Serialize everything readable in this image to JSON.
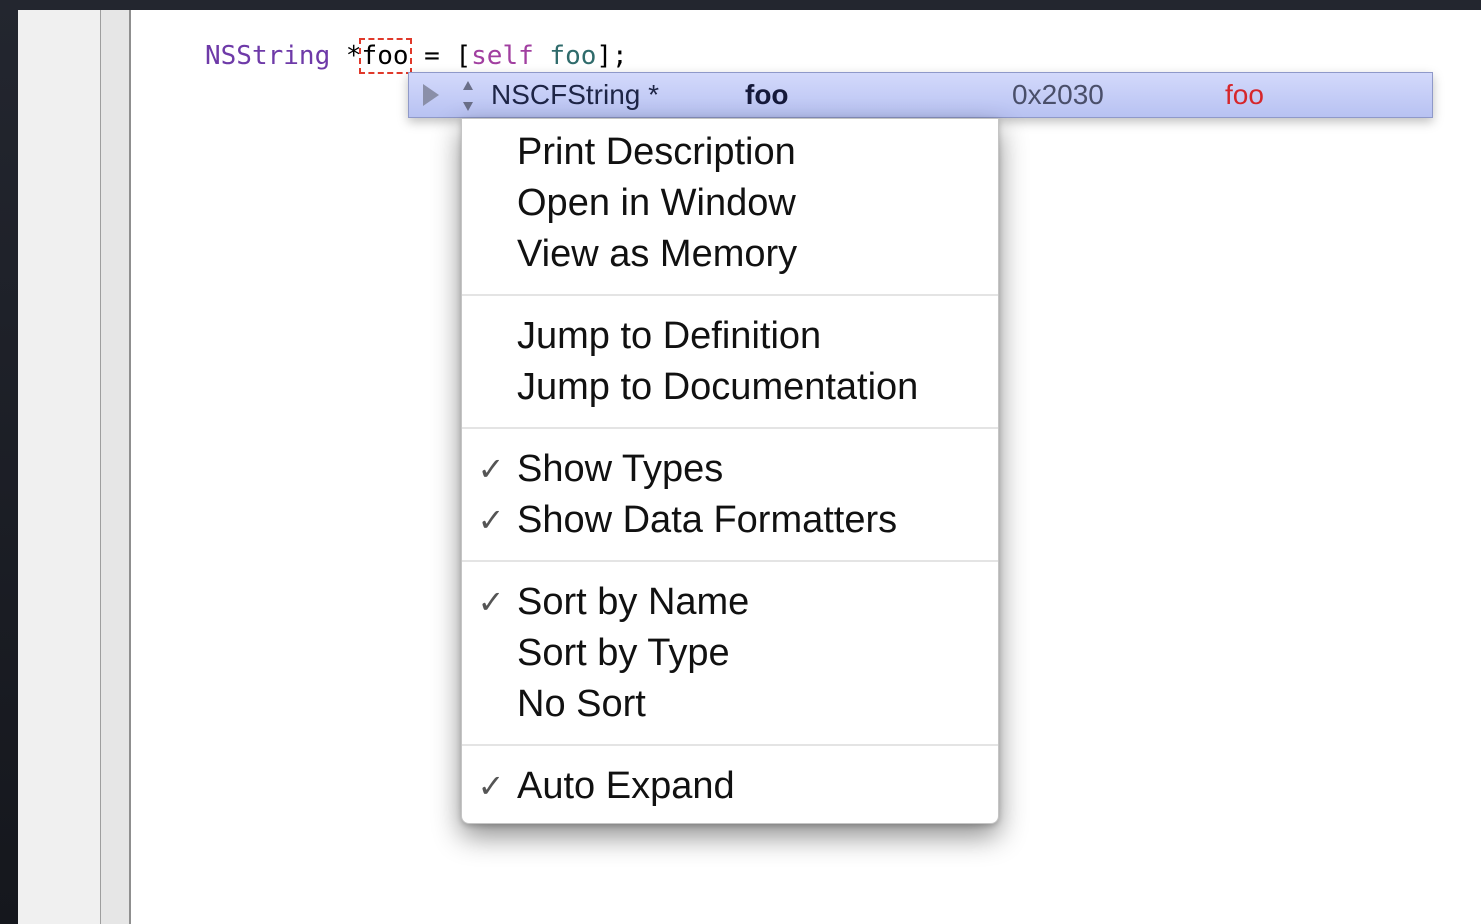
{
  "code": {
    "type_token": "NSString",
    "pointer_star": " *",
    "var_token": "foo",
    "assign": " = [",
    "self_token": "self",
    "space": " ",
    "method_token": "foo",
    "end": "];"
  },
  "datatip": {
    "type": "NSCFString *",
    "name": "foo",
    "address": "0x2030",
    "value": "foo"
  },
  "menu": {
    "groups": [
      {
        "items": [
          {
            "label": "Print Description",
            "checked": false
          },
          {
            "label": "Open in Window",
            "checked": false
          },
          {
            "label": "View as Memory",
            "checked": false
          }
        ]
      },
      {
        "items": [
          {
            "label": "Jump to Definition",
            "checked": false
          },
          {
            "label": "Jump to Documentation",
            "checked": false
          }
        ]
      },
      {
        "items": [
          {
            "label": "Show Types",
            "checked": true
          },
          {
            "label": "Show Data Formatters",
            "checked": true
          }
        ]
      },
      {
        "items": [
          {
            "label": "Sort by Name",
            "checked": true
          },
          {
            "label": "Sort by Type",
            "checked": false
          },
          {
            "label": "No Sort",
            "checked": false
          }
        ]
      },
      {
        "items": [
          {
            "label": "Auto Expand",
            "checked": true
          }
        ]
      }
    ],
    "check_glyph": "✓"
  }
}
